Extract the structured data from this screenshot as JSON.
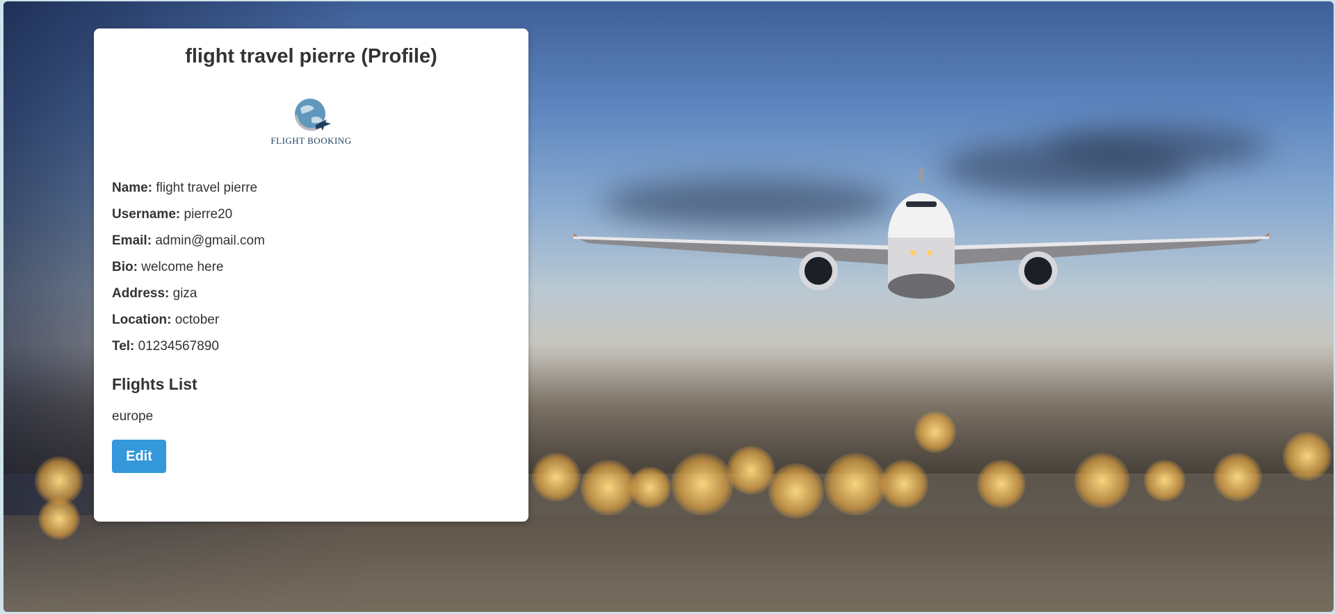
{
  "profile": {
    "title": "flight travel pierre (Profile)",
    "logo_text": "FLIGHT BOOKING",
    "fields": [
      {
        "label": "Name:",
        "value": "flight travel pierre"
      },
      {
        "label": "Username:",
        "value": "pierre20"
      },
      {
        "label": "Email:",
        "value": "admin@gmail.com"
      },
      {
        "label": "Bio:",
        "value": "welcome here"
      },
      {
        "label": "Address:",
        "value": "giza"
      },
      {
        "label": "Location:",
        "value": "october"
      },
      {
        "label": "Tel:",
        "value": "01234567890"
      }
    ],
    "flights_heading": "Flights List",
    "flights": [
      "europe"
    ],
    "edit_label": "Edit"
  },
  "colors": {
    "accent": "#3498db",
    "text": "#333333",
    "card": "#ffffff"
  },
  "background": {
    "icon": "airplane-sunset-photo"
  }
}
